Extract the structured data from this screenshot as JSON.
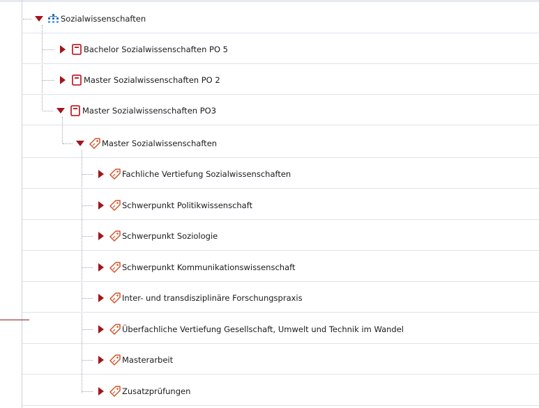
{
  "tree": {
    "root": {
      "label": "Sozialwissenschaften",
      "icon": "org-unit-icon",
      "expanded": true
    },
    "programs": [
      {
        "label": "Bachelor Sozialwissenschaften PO 5",
        "icon": "program-icon",
        "expanded": false
      },
      {
        "label": "Master Sozialwissenschaften PO 2",
        "icon": "program-icon",
        "expanded": false
      },
      {
        "label": "Master Sozialwissenschaften PO3",
        "icon": "program-icon",
        "expanded": true
      }
    ],
    "module_root": {
      "label": "Master Sozialwissenschaften",
      "icon": "tag-icon",
      "expanded": true
    },
    "modules": [
      {
        "label": "Fachliche Vertiefung Sozialwissenschaften",
        "icon": "tag-icon"
      },
      {
        "label": "Schwerpunkt Politikwissenschaft",
        "icon": "tag-icon"
      },
      {
        "label": "Schwerpunkt Soziologie",
        "icon": "tag-icon"
      },
      {
        "label": "Schwerpunkt Kommunikationswissenschaft",
        "icon": "tag-icon"
      },
      {
        "label": "Inter- und transdisziplinäre Forschungspraxis",
        "icon": "tag-icon"
      },
      {
        "label": "Überfachliche Vertiefung Gesellschaft, Umwelt und Technik im Wandel",
        "icon": "tag-icon"
      },
      {
        "label": "Masterarbeit",
        "icon": "tag-icon"
      },
      {
        "label": "Zusatzprüfungen",
        "icon": "tag-icon"
      }
    ]
  },
  "colors": {
    "toggle": "#a3151c",
    "program_icon": "#c0272d",
    "tag_icon": "#d2542a",
    "org_icon": "#2a6fb0"
  }
}
